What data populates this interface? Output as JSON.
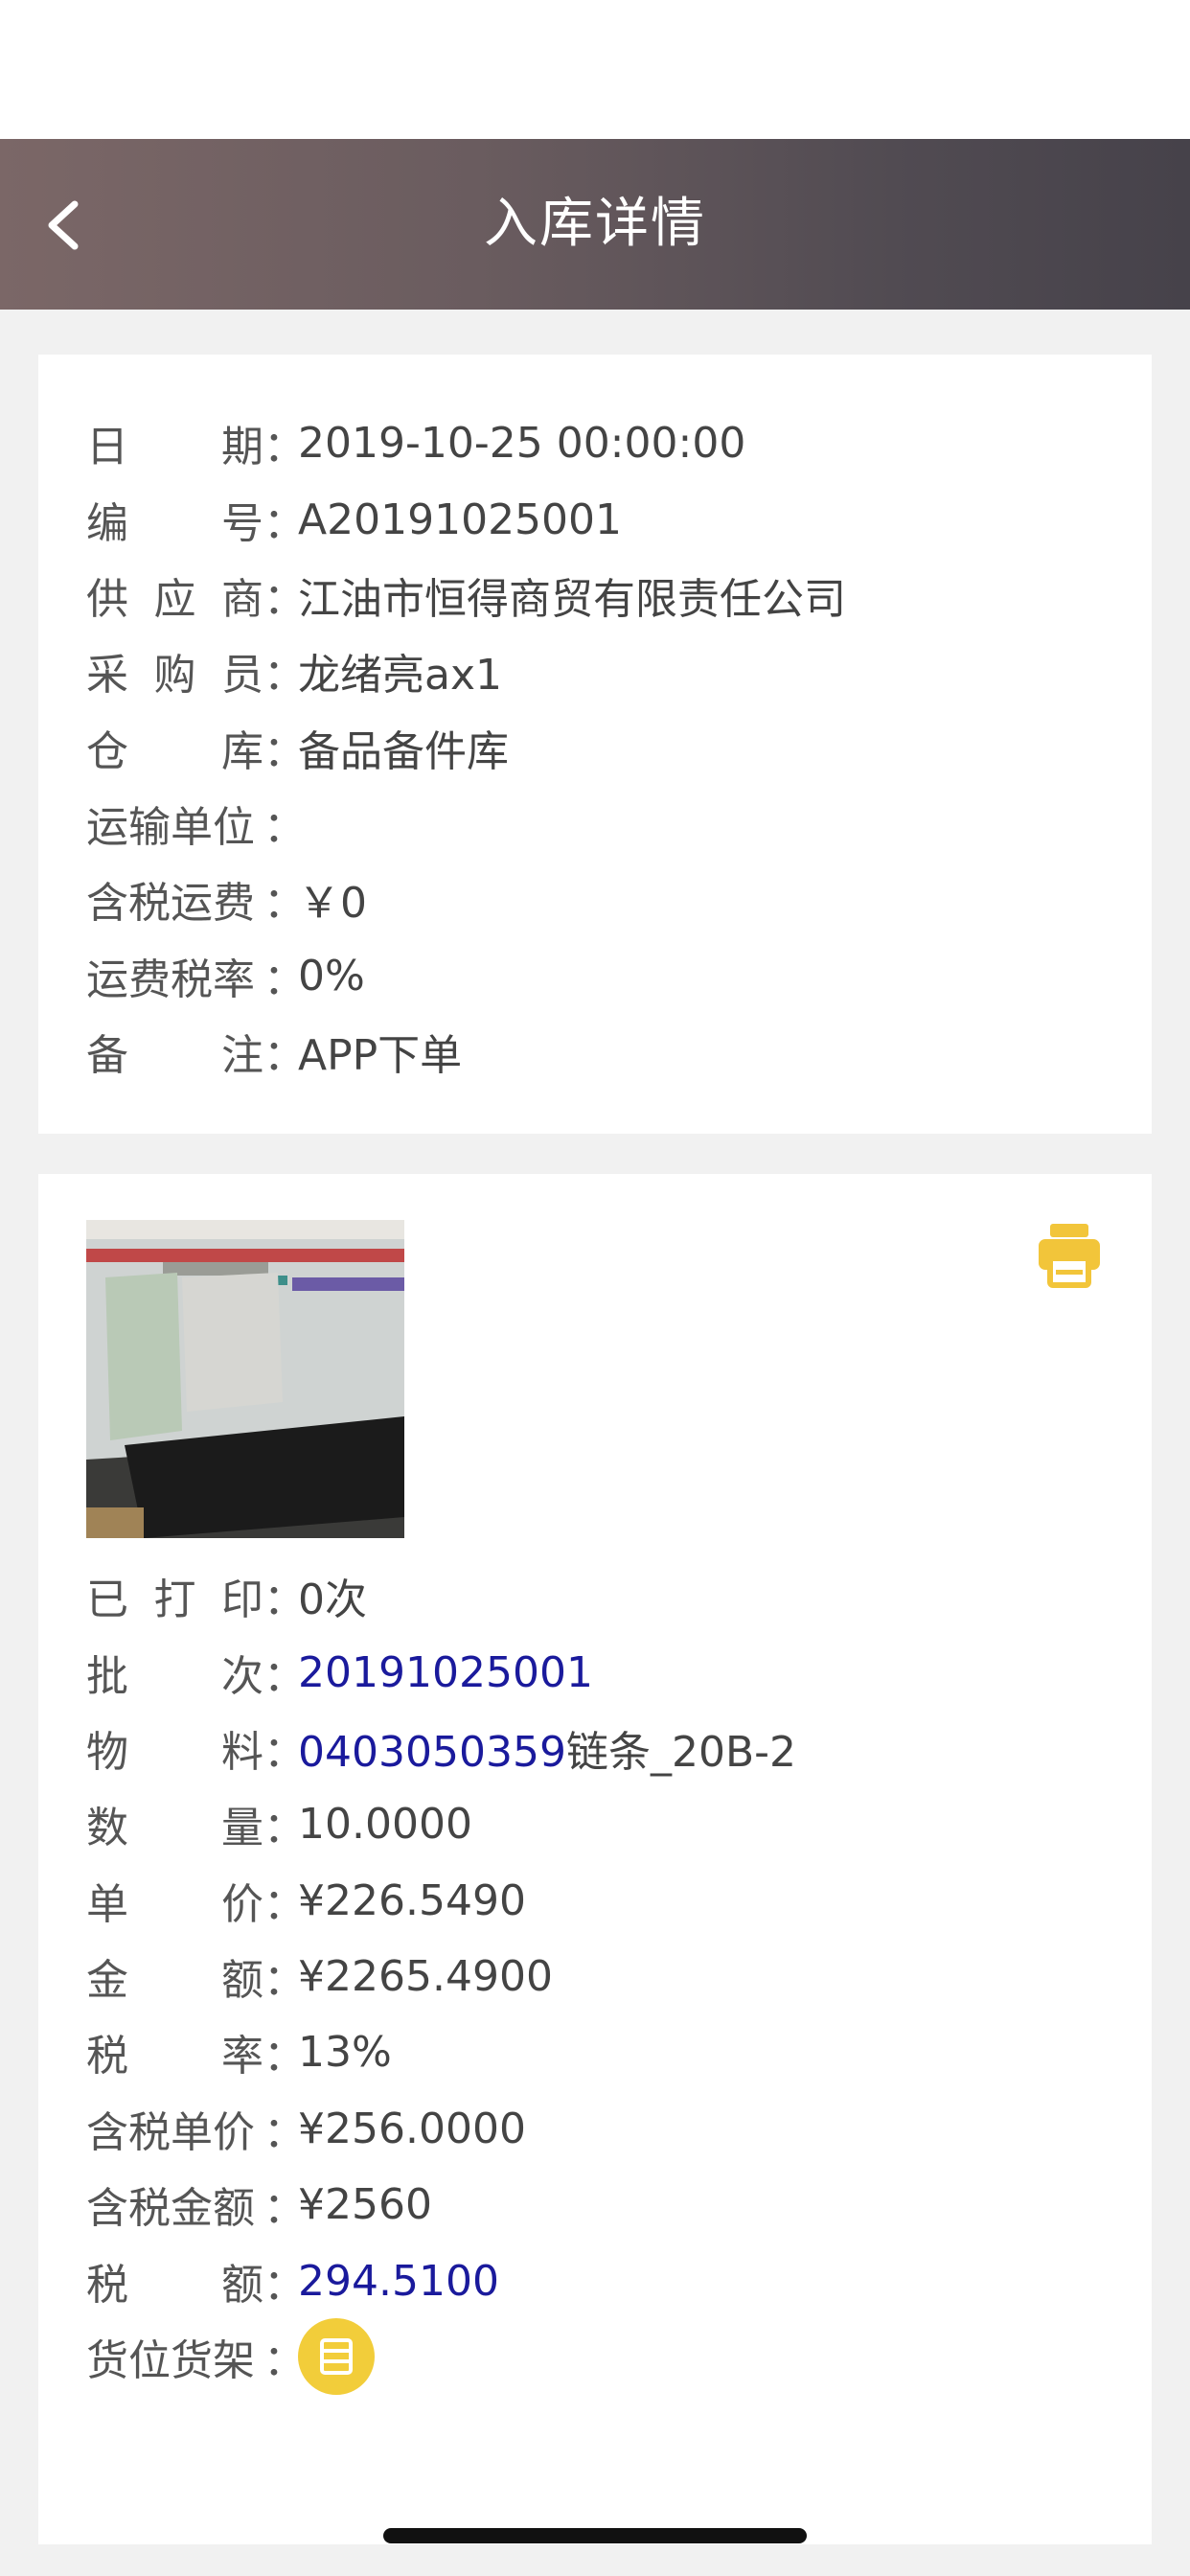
{
  "nav": {
    "title": "入库详情",
    "back_icon": "chevron-left-icon"
  },
  "info": {
    "rows": [
      {
        "label": [
          "日",
          "期"
        ],
        "value": "2019-10-25 00:00:00"
      },
      {
        "label": [
          "编",
          "号"
        ],
        "value": "A20191025001"
      },
      {
        "label": [
          "供",
          "应",
          "商"
        ],
        "value": "江油市恒得商贸有限责任公司"
      },
      {
        "label": [
          "采",
          "购",
          "员"
        ],
        "value": "龙绪亮ax1"
      },
      {
        "label": [
          "仓",
          "库"
        ],
        "value": "备品备件库"
      },
      {
        "label": [
          "运输单位"
        ],
        "value": ""
      },
      {
        "label": [
          "含税运费"
        ],
        "value": "￥0"
      },
      {
        "label": [
          "运费税率"
        ],
        "value": "0%"
      },
      {
        "label": [
          "备",
          "注"
        ],
        "value": "APP下单"
      }
    ]
  },
  "detail": {
    "print_icon": "printer-icon",
    "print_color": "#f2c53a",
    "printed": {
      "label": [
        "已",
        "打",
        "印"
      ],
      "value": "0次"
    },
    "batch": {
      "label": [
        "批",
        "次"
      ],
      "value": "20191025001"
    },
    "material": {
      "label": [
        "物",
        "料"
      ],
      "code": "0403050359",
      "name": "链条_20B-2"
    },
    "quantity": {
      "label": [
        "数",
        "量"
      ],
      "value": "10.0000"
    },
    "unit_price": {
      "label": [
        "单",
        "价"
      ],
      "value": "¥226.5490"
    },
    "amount": {
      "label": [
        "金",
        "额"
      ],
      "value": "¥2265.4900"
    },
    "tax_rate": {
      "label": [
        "税",
        "率"
      ],
      "value": "13%"
    },
    "tax_unit_price": {
      "label": [
        "含税单价"
      ],
      "value": "¥256.0000"
    },
    "tax_amount": {
      "label": [
        "含税金额"
      ],
      "value": "¥2560"
    },
    "tax": {
      "label": [
        "税",
        "额"
      ],
      "value": "294.5100"
    },
    "shelf": {
      "label": [
        "货位货架"
      ],
      "icon": "list-icon"
    },
    "link_color": "#1a1a9c"
  },
  "colon": "："
}
